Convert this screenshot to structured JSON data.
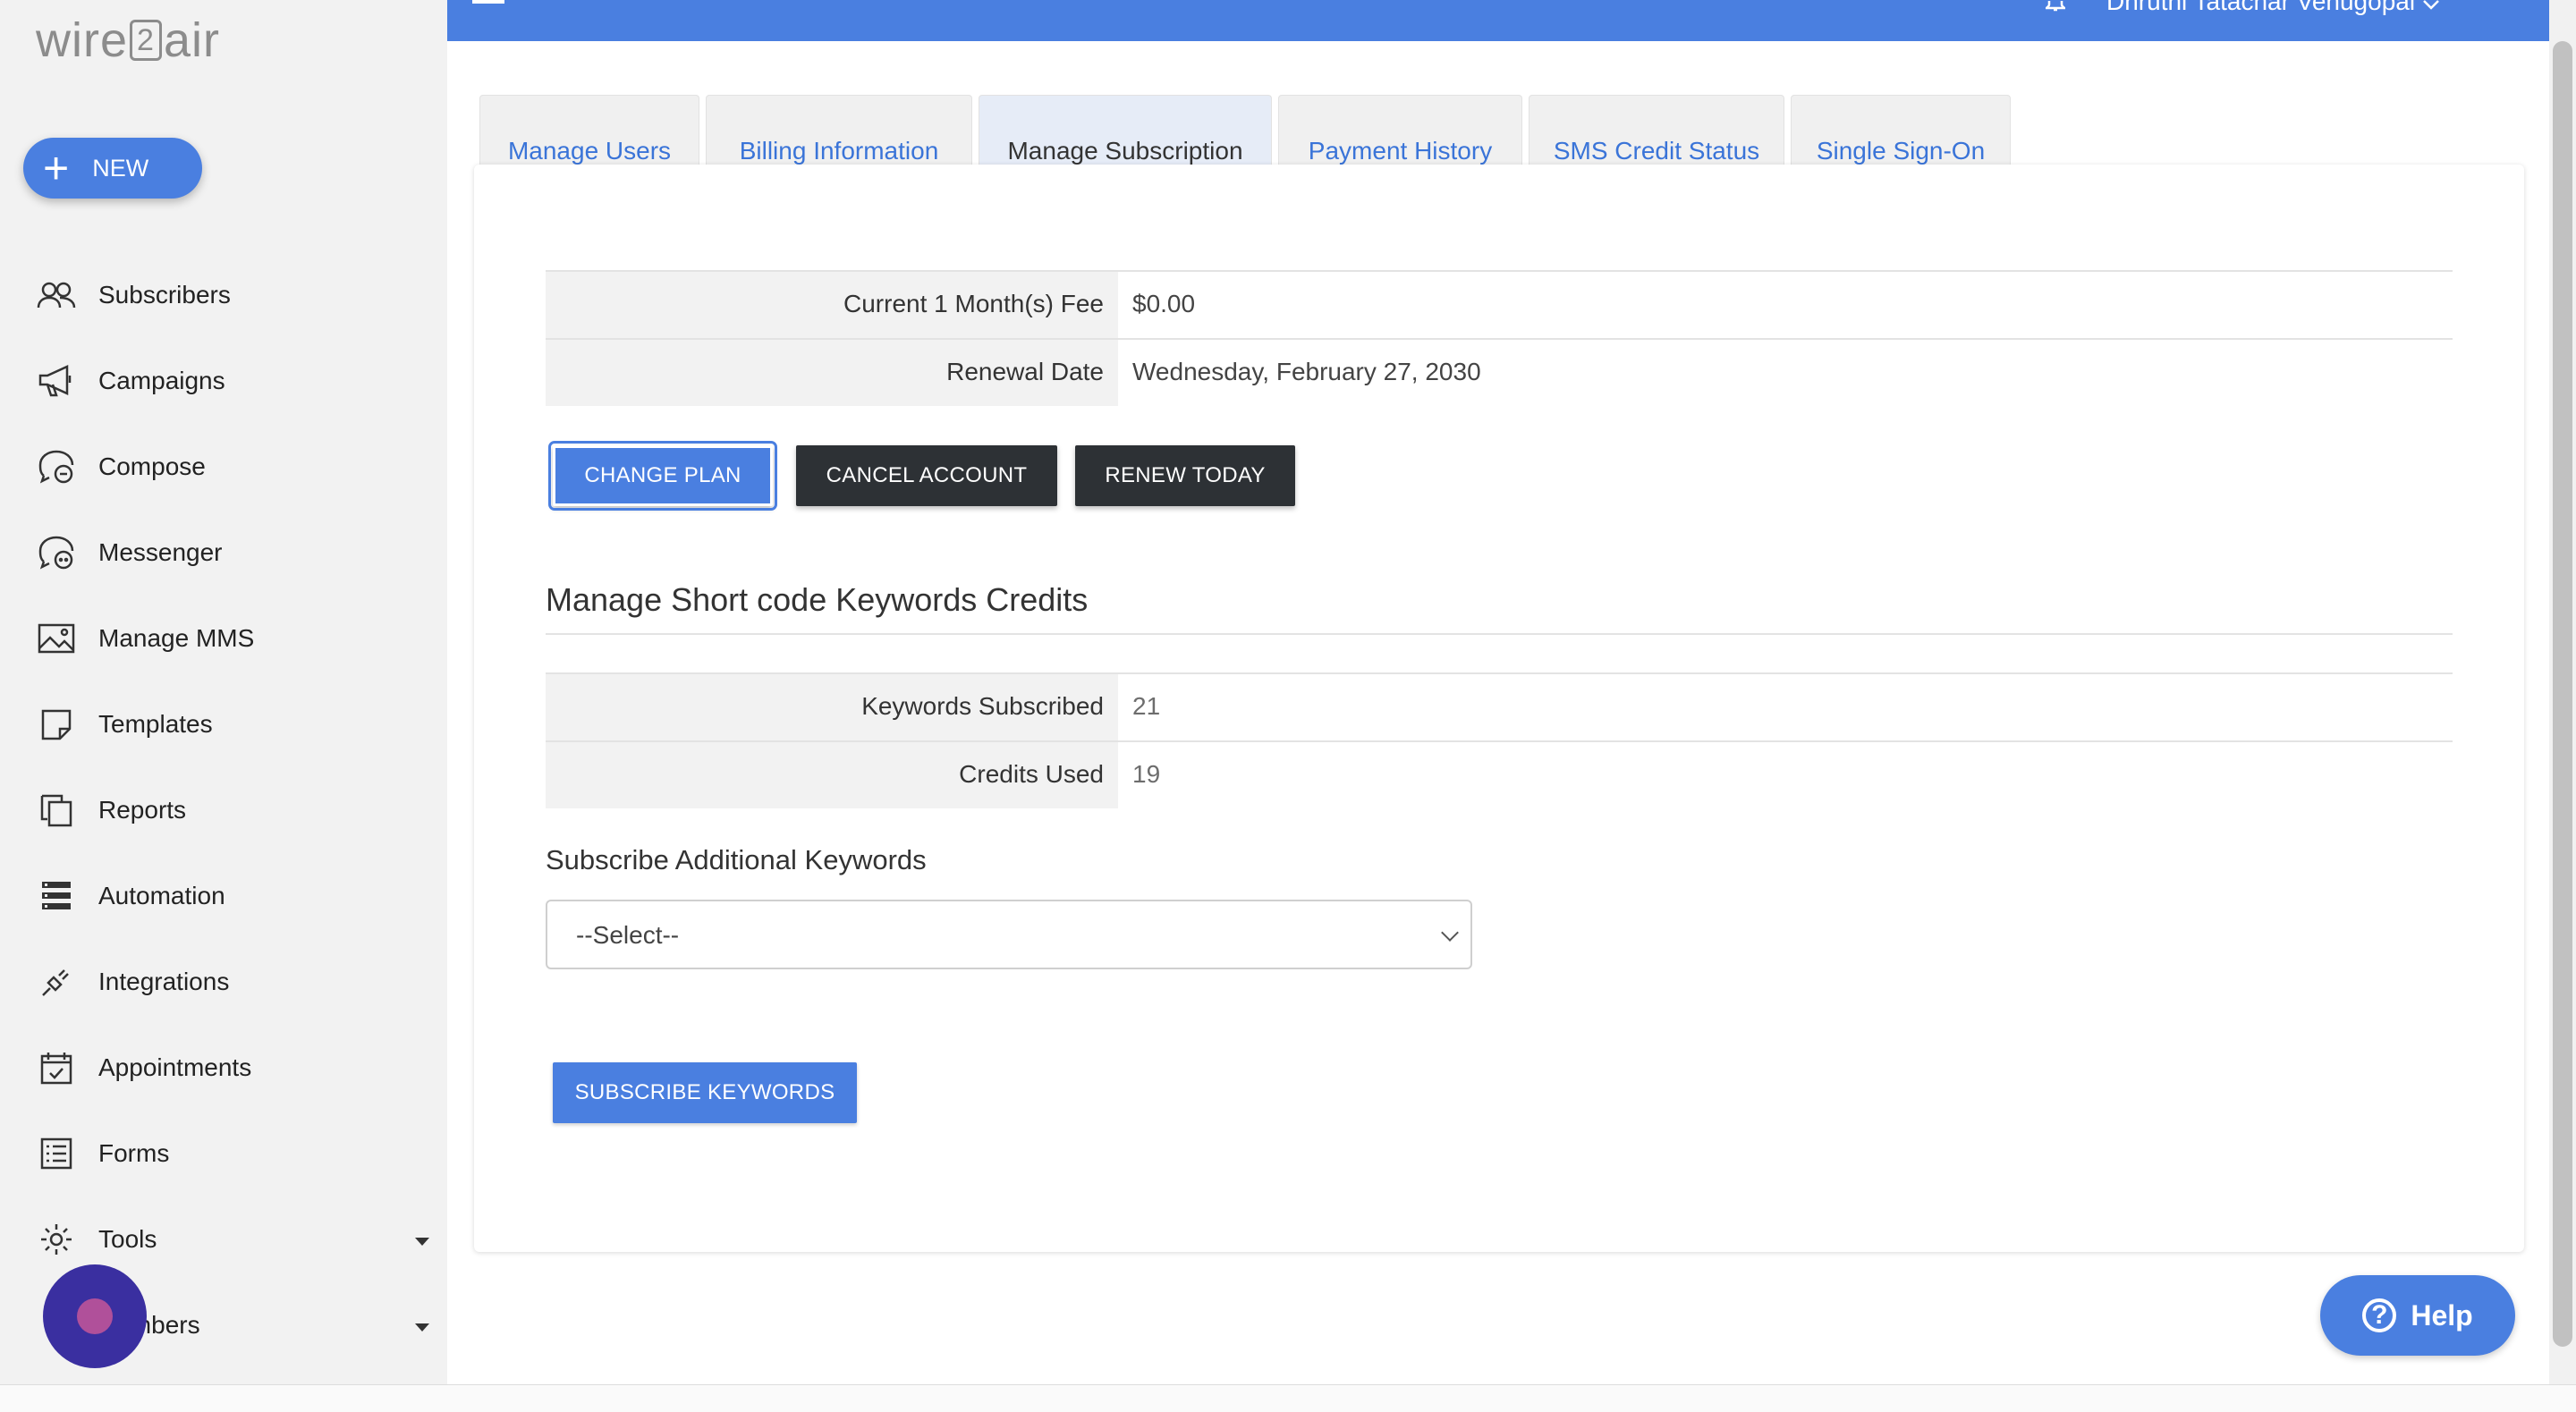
{
  "logo": {
    "left": "wire",
    "mid": "2",
    "right": "air"
  },
  "new_button": {
    "label": "NEW"
  },
  "sidebar": {
    "items": [
      {
        "label": "Subscribers",
        "icon": "users-icon"
      },
      {
        "label": "Campaigns",
        "icon": "megaphone-icon"
      },
      {
        "label": "Compose",
        "icon": "compose-chat-icon"
      },
      {
        "label": "Messenger",
        "icon": "messenger-chat-icon"
      },
      {
        "label": "Manage MMS",
        "icon": "image-icon"
      },
      {
        "label": "Templates",
        "icon": "template-note-icon"
      },
      {
        "label": "Reports",
        "icon": "reports-copy-icon"
      },
      {
        "label": "Automation",
        "icon": "automation-stack-icon"
      },
      {
        "label": "Integrations",
        "icon": "plug-icon"
      },
      {
        "label": "Appointments",
        "icon": "calendar-check-icon"
      },
      {
        "label": "Forms",
        "icon": "form-list-icon"
      },
      {
        "label": "Tools",
        "icon": "gear-icon"
      },
      {
        "label": "Numbers",
        "icon": "phone-icon"
      }
    ]
  },
  "topbar": {
    "user_name": "Dhruthi Tatachar Venugopal"
  },
  "tabs": [
    {
      "label": "Manage Users",
      "active": false
    },
    {
      "label": "Billing Information",
      "active": false
    },
    {
      "label": "Manage Subscription",
      "active": true
    },
    {
      "label": "Payment History",
      "active": false
    },
    {
      "label": "SMS Credit Status",
      "active": false
    },
    {
      "label": "Single Sign-On",
      "active": false
    }
  ],
  "subscription": {
    "rows": [
      {
        "key": "Current 1 Month(s) Fee",
        "value": "$0.00"
      },
      {
        "key": "Renewal Date",
        "value": "Wednesday, February 27, 2030"
      }
    ],
    "buttons": {
      "change_plan": "CHANGE PLAN",
      "cancel_account": "CANCEL ACCOUNT",
      "renew_today": "RENEW TODAY"
    }
  },
  "keywords": {
    "title": "Manage Short code Keywords Credits",
    "rows": [
      {
        "key": "Keywords Subscribed",
        "value": "21"
      },
      {
        "key": "Credits Used",
        "value": "19"
      }
    ],
    "subscribe_label": "Subscribe Additional Keywords",
    "select_value": "--Select--",
    "subscribe_button": "SUBSCRIBE KEYWORDS"
  },
  "help": {
    "label": "Help"
  },
  "colors": {
    "accent": "#4a7fe0",
    "dark_button": "#2d3135",
    "chat_bubble": "#3a2fa0"
  }
}
